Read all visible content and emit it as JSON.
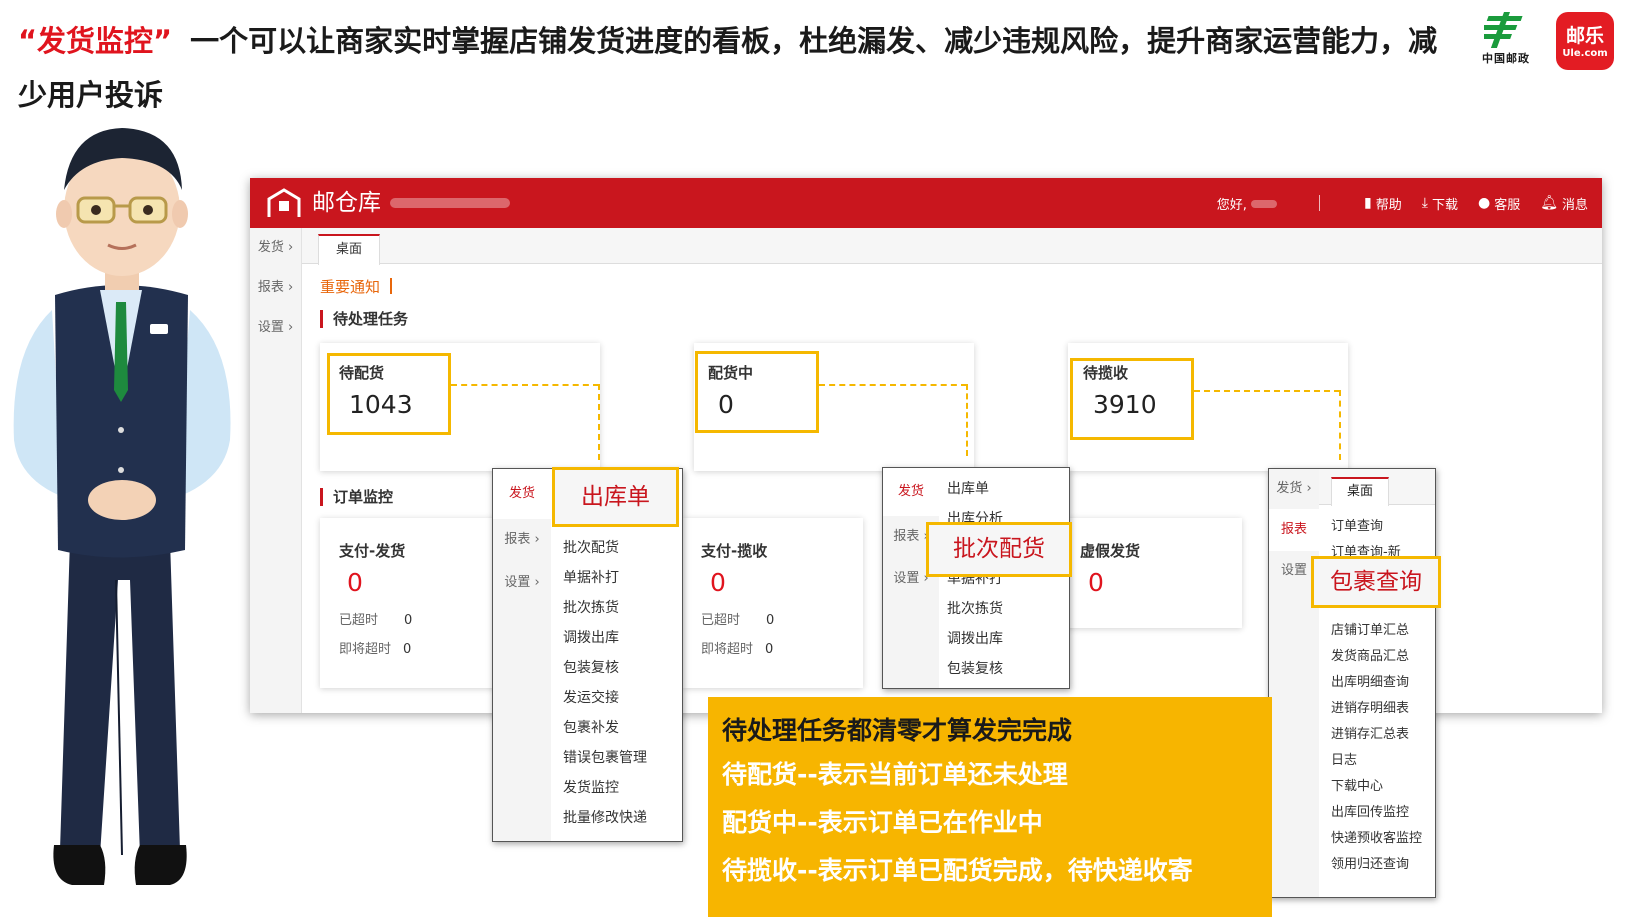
{
  "slide": {
    "title_highlight": "“发货监控”",
    "title_rest": "一个可以让商家实时掌握店铺发货进度的看板，杜绝漏发、减少违规风险，提升商家运营能力，减少用户投诉",
    "logo_post_text": "中国邮政",
    "logo_ule_main": "邮乐",
    "logo_ule_sub": "Ule.com"
  },
  "app": {
    "name": "邮仓库",
    "header": {
      "greeting": "您好,",
      "nav": [
        {
          "icon": "book-icon",
          "label": "帮助"
        },
        {
          "icon": "download-icon",
          "label": "下载"
        },
        {
          "icon": "user-icon",
          "label": "客服"
        },
        {
          "icon": "bell-icon",
          "label": "消息"
        }
      ]
    },
    "sidebar": [
      "发货 ›",
      "报表 ›",
      "设置 ›"
    ],
    "tab": "桌面",
    "notice": "重要通知",
    "pending": {
      "title": "待处理任务",
      "cards": [
        {
          "label": "待配货",
          "value": "1043"
        },
        {
          "label": "配货中",
          "value": "0"
        },
        {
          "label": "待揽收",
          "value": "3910"
        }
      ]
    },
    "monitor": {
      "title": "订单监控",
      "cards": [
        {
          "label": "支付-发货",
          "value": "0",
          "overdue_label": "已超时",
          "overdue": "0",
          "soon_label": "即将超时",
          "soon": "0"
        },
        {
          "label": "支付-揽收",
          "value": "0",
          "overdue_label": "已超时",
          "overdue": "0",
          "soon_label": "即将超时",
          "soon": "0"
        },
        {
          "label": "虚假发货",
          "value": "0"
        }
      ]
    }
  },
  "popup1": {
    "side": [
      "发货",
      "报表 ›",
      "设置 ›"
    ],
    "callout": "出库单",
    "items": [
      "批次配货",
      "单据补打",
      "批次拣货",
      "调拨出库",
      "包装复核",
      "发运交接",
      "包裹补发",
      "错误包裹管理",
      "发货监控",
      "批量修改快递"
    ]
  },
  "popup2": {
    "side": [
      "发货",
      "报表 ›",
      "设置 ›"
    ],
    "items": [
      "出库单",
      "出库分析",
      "单据补打",
      "批次拣货",
      "调拨出库",
      "包装复核"
    ],
    "callout": "批次配货"
  },
  "popup3": {
    "side": [
      "发货 ›",
      "报表",
      "设置"
    ],
    "tab": "桌面",
    "items_top": [
      "订单查询",
      "订单查询-新"
    ],
    "callout": "包裹查询",
    "items": [
      "店铺订单汇总",
      "发货商品汇总",
      "出库明细查询",
      "进销存明细表",
      "进销存汇总表",
      "日志",
      "下载中心",
      "出库回传监控",
      "快递预收客监控",
      "领用归还查询"
    ]
  },
  "note": {
    "head": "待处理任务都清零才算发完完成",
    "lines": [
      "待配货--表示当前订单还未处理",
      "配货中--表示订单已在作业中",
      "待揽收--表示订单已配货完成，待快递收寄"
    ]
  },
  "colors": {
    "brand_red": "#c9161e",
    "highlight_yellow": "#f5b800",
    "note_bg": "#f7b500",
    "notice_orange": "#e8670c"
  }
}
